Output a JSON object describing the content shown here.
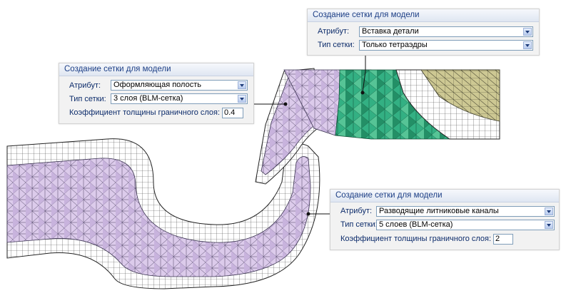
{
  "panels": {
    "top_right": {
      "title": "Создание сетки для модели",
      "attribute_label": "Атрибут:",
      "attribute_value": "Вставка детали",
      "mesh_type_label": "Тип сетки:",
      "mesh_type_value": "Только тетраэдры"
    },
    "left": {
      "title": "Создание сетки для модели",
      "attribute_label": "Атрибут:",
      "attribute_value": "Оформляющая полость",
      "mesh_type_label": "Тип сетки:",
      "mesh_type_value": "3 слоя (BLM-сетка)",
      "thickness_label": "Коэффициент толщины граничного слоя:",
      "thickness_value": "0.4"
    },
    "bottom_right": {
      "title": "Создание сетки для модели",
      "attribute_label": "Атрибут:",
      "attribute_value": "Разводящие литниковые каналы",
      "mesh_type_label": "Тип сетки:",
      "mesh_type_value": "5 слоев (BLM-сетка)",
      "thickness_label": "Коэффициент толщины граничного слоя:",
      "thickness_value": "2"
    }
  },
  "colors": {
    "panel_title_text": "#1d3f86",
    "cavity_fill": "#d9c7ea",
    "insert_fill": "#2fa37a",
    "part_fill": "#c9c48f",
    "mesh_line": "#3a3a3a"
  }
}
